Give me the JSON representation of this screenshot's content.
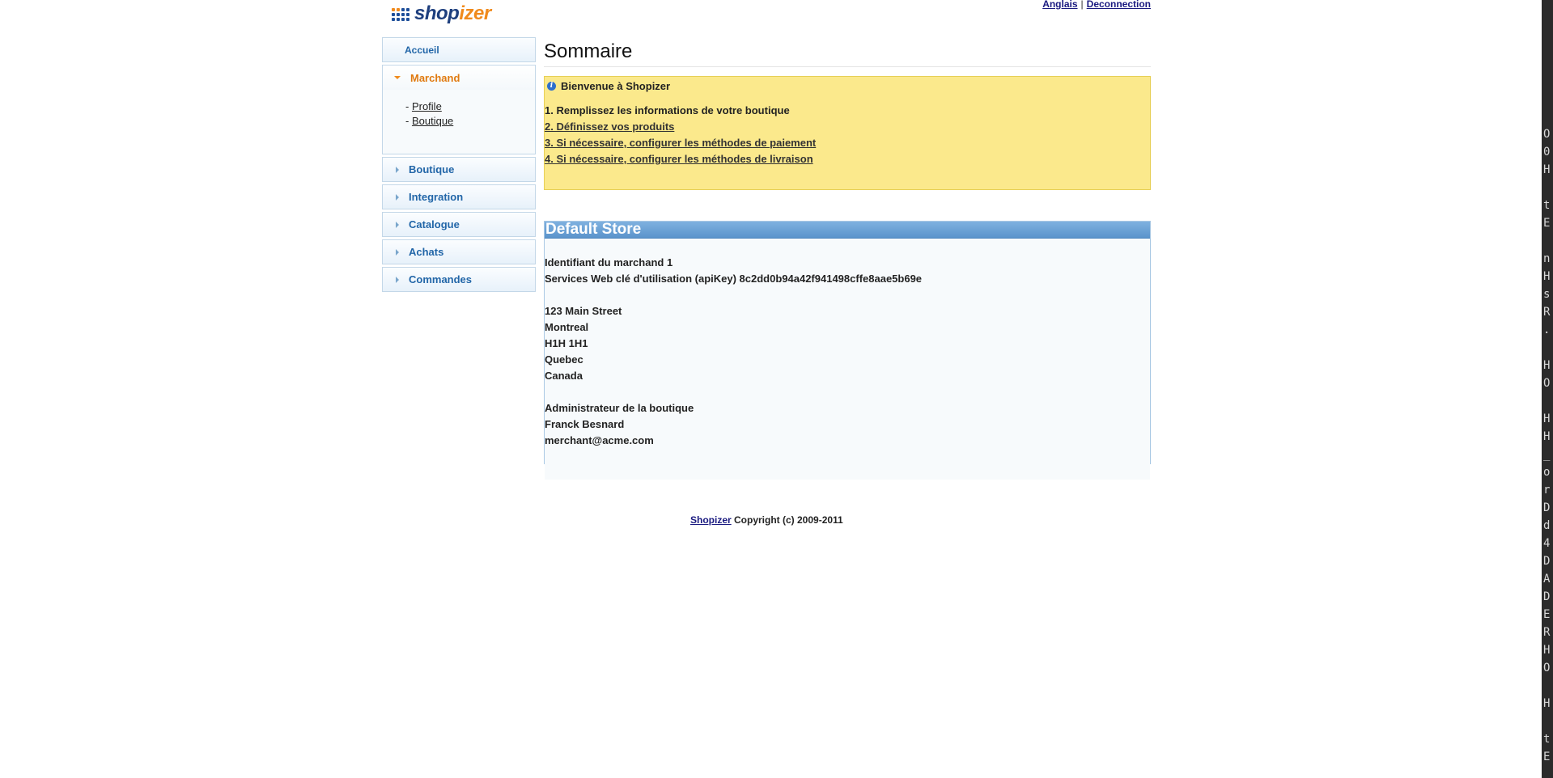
{
  "header": {
    "logo_shop": "shop",
    "logo_izer": "izer",
    "lang_link": "Anglais",
    "separator": "|",
    "logout_link": "Deconnection"
  },
  "sidebar": {
    "home": "Accueil",
    "active": "Marchand",
    "sub_prefix": "- ",
    "sub_items": [
      "Profile",
      "Boutique"
    ],
    "items": [
      "Boutique",
      "Integration",
      "Catalogue",
      "Achats",
      "Commandes"
    ]
  },
  "main": {
    "title": "Sommaire",
    "notice": {
      "heading": "Bienvenue à Shopizer",
      "step1": "1. Remplissez les informations de votre boutique",
      "step2": "2. Définissez vos produits",
      "step3": "3. Si nécessaire, configurer les méthodes de paiement",
      "step4": "4. Si nécessaire, configurer les méthodes de livraison"
    },
    "store": {
      "name": "Default Store",
      "merchant_id": "Identifiant du marchand 1",
      "api_key": "Services Web clé d'utilisation (apiKey) 8c2dd0b94a42f941498cffe8aae5b69e",
      "address": [
        "123 Main Street",
        "Montreal",
        "H1H 1H1",
        "Quebec",
        "Canada"
      ],
      "admin_label": "Administrateur de la boutique",
      "admin_name": "Franck Besnard",
      "admin_email": "merchant@acme.com"
    }
  },
  "footer": {
    "link": "Shopizer",
    "text": " Copyright (c) 2009-2011"
  },
  "terminal_strip": [
    "O",
    "0",
    "H",
    "",
    "t",
    "E",
    "",
    "n",
    "H",
    "s",
    "R",
    ".",
    "",
    "H",
    "O",
    "",
    "H",
    "H",
    "_",
    "o",
    "r",
    "D",
    "d",
    "4",
    "D",
    "A",
    "D",
    "E",
    "R",
    "H",
    "O",
    "",
    "H",
    "",
    "t",
    "E"
  ],
  "colors": {
    "accent_blue": "#2266a8",
    "accent_orange": "#e07a10",
    "notice_bg": "#fbe98c",
    "store_header": "#5b94cc"
  }
}
